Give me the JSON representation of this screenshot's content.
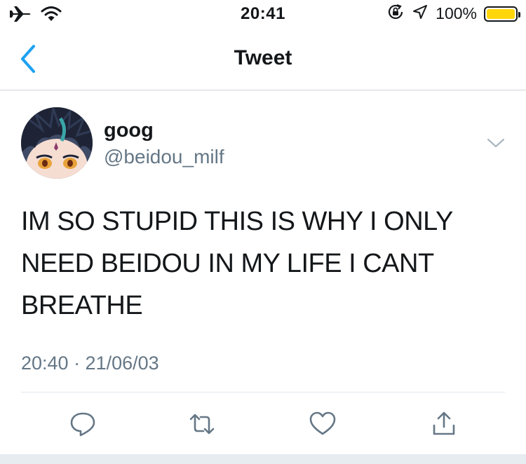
{
  "status_bar": {
    "time": "20:41",
    "battery_percent": "100%",
    "icons": [
      "airplane-icon",
      "wifi-icon",
      "orientation-lock-icon",
      "location-icon",
      "battery-icon"
    ],
    "battery_color": "#ffd60a"
  },
  "nav": {
    "title": "Tweet",
    "back_icon": "chevron-left-icon",
    "accent_color": "#1da1f2"
  },
  "tweet": {
    "display_name": "goog",
    "handle": "@beidou_milf",
    "text": "IM SO STUPID THIS IS WHY I ONLY NEED BEIDOU IN MY LIFE I CANT BREATHE",
    "timestamp": "20:40 · 21/06/03",
    "menu_icon": "chevron-down-icon"
  },
  "actions": [
    {
      "icon": "reply-icon"
    },
    {
      "icon": "retweet-icon"
    },
    {
      "icon": "like-icon"
    },
    {
      "icon": "share-icon"
    }
  ]
}
